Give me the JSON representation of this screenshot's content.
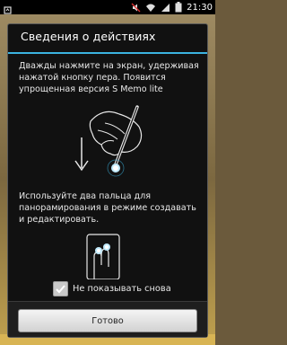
{
  "status_bar": {
    "time": "21:30",
    "icons": [
      "usb-icon",
      "mute-icon",
      "wifi-icon",
      "signal-icon",
      "battery-icon"
    ]
  },
  "dialog": {
    "title": "Сведения о действиях",
    "text1": "Дважды нажмите на экран, удерживая нажатой кнопку пера. Появится упрощенная версия S Memo lite",
    "text2": "Используйте два пальца для панорамирования в режиме создавать и редактировать.",
    "checkbox_label": "Не показывать снова",
    "checkbox_checked": true,
    "ok_button": "Готово"
  },
  "colors": {
    "accent": "#3bb3e0",
    "dialog_bg": "#111111",
    "text": "#e8e8e8"
  }
}
